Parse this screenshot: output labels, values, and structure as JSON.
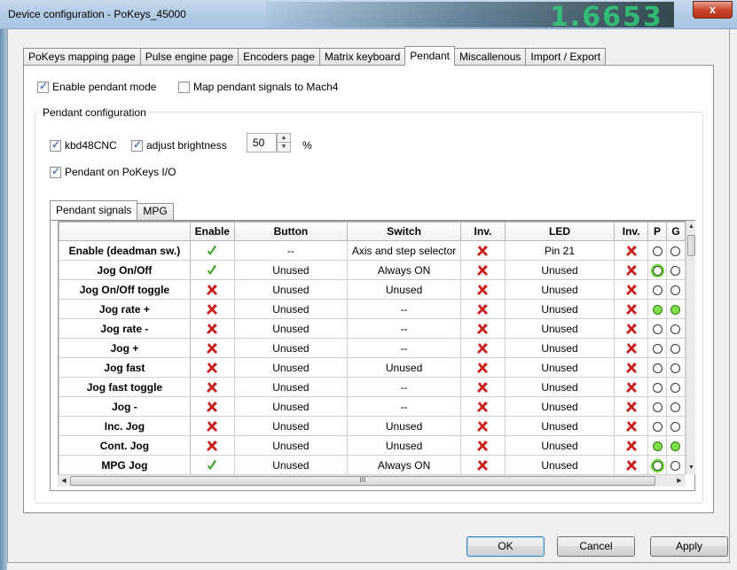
{
  "window": {
    "title": "Device configuration - PoKeys_45000",
    "close_label": "x",
    "background_digits": "1.6653"
  },
  "tabs": [
    {
      "label": "PoKeys mapping page",
      "active": false
    },
    {
      "label": "Pulse engine page",
      "active": false
    },
    {
      "label": "Encoders page",
      "active": false
    },
    {
      "label": "Matrix keyboard",
      "active": false
    },
    {
      "label": "Pendant",
      "active": true
    },
    {
      "label": "Miscallenous",
      "active": false
    },
    {
      "label": "Import / Export",
      "active": false
    }
  ],
  "options": {
    "enable_pendant": {
      "label": "Enable pendant mode",
      "checked": true
    },
    "map_signals": {
      "label": "Map pendant signals to Mach4",
      "checked": false
    }
  },
  "pendant_config": {
    "title": "Pendant configuration",
    "kbd48cnc": {
      "label": "kbd48CNC",
      "checked": true
    },
    "adjust_brightness": {
      "label": "adjust brightness",
      "checked": true
    },
    "brightness_value": "50",
    "brightness_unit": "%",
    "pendant_on_io": {
      "label": "Pendant on PoKeys I/O",
      "checked": true
    }
  },
  "inner_tabs": [
    {
      "label": "Pendant signals",
      "active": true
    },
    {
      "label": "MPG",
      "active": false
    }
  ],
  "grid": {
    "columns": [
      "",
      "Enable",
      "Button",
      "Switch",
      "Inv.",
      "LED",
      "Inv.",
      "P",
      "G"
    ],
    "rows": [
      {
        "name": "Enable (deadman sw.)",
        "enable": "ok",
        "button": "--",
        "switch": "Axis and step selector",
        "inv1": "x",
        "led": "Pin 21",
        "inv2": "x",
        "p": "off",
        "g": "off"
      },
      {
        "name": "Jog On/Off",
        "enable": "ok",
        "button": "Unused",
        "switch": "Always ON",
        "inv1": "x",
        "led": "Unused",
        "inv2": "x",
        "p": "focus",
        "g": "off"
      },
      {
        "name": "Jog On/Off toggle",
        "enable": "x",
        "button": "Unused",
        "switch": "Unused",
        "inv1": "x",
        "led": "Unused",
        "inv2": "x",
        "p": "off",
        "g": "off"
      },
      {
        "name": "Jog rate +",
        "enable": "x",
        "button": "Unused",
        "switch": "--",
        "inv1": "x",
        "led": "Unused",
        "inv2": "x",
        "p": "on",
        "g": "on"
      },
      {
        "name": "Jog rate -",
        "enable": "x",
        "button": "Unused",
        "switch": "--",
        "inv1": "x",
        "led": "Unused",
        "inv2": "x",
        "p": "off",
        "g": "off"
      },
      {
        "name": "Jog +",
        "enable": "x",
        "button": "Unused",
        "switch": "--",
        "inv1": "x",
        "led": "Unused",
        "inv2": "x",
        "p": "off",
        "g": "off"
      },
      {
        "name": "Jog fast",
        "enable": "x",
        "button": "Unused",
        "switch": "Unused",
        "inv1": "x",
        "led": "Unused",
        "inv2": "x",
        "p": "off",
        "g": "off"
      },
      {
        "name": "Jog fast toggle",
        "enable": "x",
        "button": "Unused",
        "switch": "--",
        "inv1": "x",
        "led": "Unused",
        "inv2": "x",
        "p": "off",
        "g": "off"
      },
      {
        "name": "Jog -",
        "enable": "x",
        "button": "Unused",
        "switch": "--",
        "inv1": "x",
        "led": "Unused",
        "inv2": "x",
        "p": "off",
        "g": "off"
      },
      {
        "name": "Inc. Jog",
        "enable": "x",
        "button": "Unused",
        "switch": "Unused",
        "inv1": "x",
        "led": "Unused",
        "inv2": "x",
        "p": "off",
        "g": "off"
      },
      {
        "name": "Cont. Jog",
        "enable": "x",
        "button": "Unused",
        "switch": "Unused",
        "inv1": "x",
        "led": "Unused",
        "inv2": "x",
        "p": "on",
        "g": "on"
      },
      {
        "name": "MPG Jog",
        "enable": "ok",
        "button": "Unused",
        "switch": "Always ON",
        "inv1": "x",
        "led": "Unused",
        "inv2": "x",
        "p": "focus",
        "g": "off"
      }
    ]
  },
  "scroll": {
    "h_thumb_grip": "III"
  },
  "buttons": {
    "ok": "OK",
    "cancel": "Cancel",
    "apply": "Apply"
  },
  "colors": {
    "ok_mark": "#2f9e1a",
    "x_mark": "#c8201c",
    "radio_on": "#7fe04a"
  }
}
